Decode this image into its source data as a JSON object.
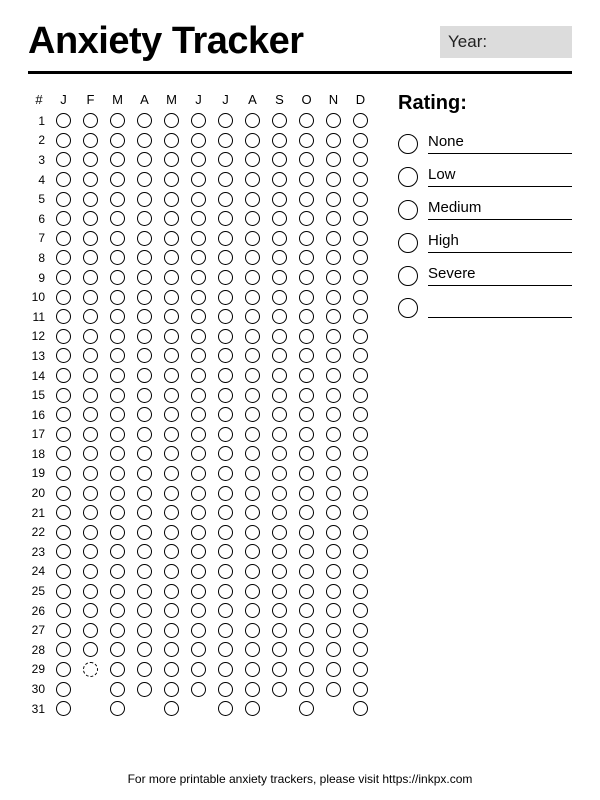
{
  "title": "Anxiety Tracker",
  "year_label": "Year:",
  "hash": "#",
  "months": [
    "J",
    "F",
    "M",
    "A",
    "M",
    "J",
    "J",
    "A",
    "S",
    "O",
    "N",
    "D"
  ],
  "month_lengths": [
    31,
    29,
    31,
    30,
    31,
    30,
    31,
    31,
    30,
    31,
    30,
    31
  ],
  "dashed_default": {
    "row": 29,
    "month_index": 1
  },
  "rating": {
    "title": "Rating:",
    "items": [
      "None",
      "Low",
      "Medium",
      "High",
      "Severe",
      ""
    ]
  },
  "footer": "For more printable anxiety trackers, please visit https://inkpx.com"
}
